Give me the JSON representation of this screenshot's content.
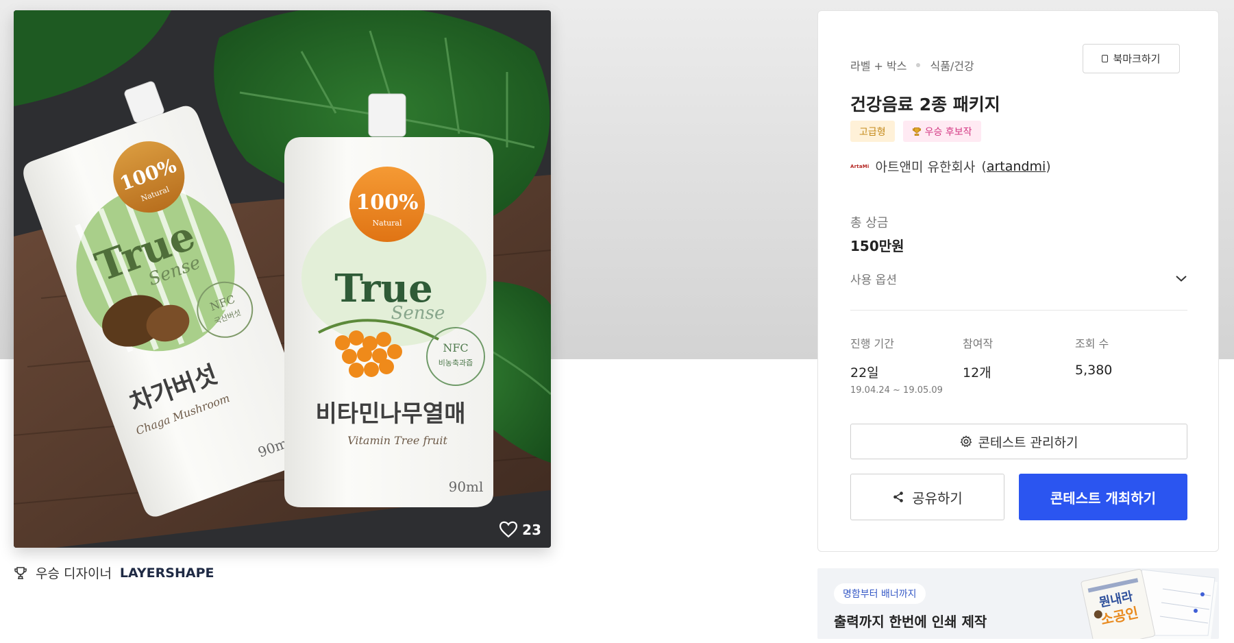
{
  "colors": {
    "primary": "#2b55f0",
    "premium_bg": "#fff1d8",
    "premium_text": "#c48a1c",
    "finalist_bg": "#ffeaf3",
    "finalist_text": "#d33883"
  },
  "product_image": {
    "left_pouch": {
      "badge_big": "100%",
      "badge_small": "Natural",
      "brand": "True",
      "brand_script": "Sense",
      "seal_top": "NFC",
      "seal_bottom": "국산버섯",
      "name_ko": "차가버섯",
      "name_en": "Chaga Mushroom",
      "volume": "90ml"
    },
    "right_pouch": {
      "badge_big": "100%",
      "badge_small": "Natural",
      "brand": "True",
      "brand_script": "Sense",
      "seal_top": "NFC",
      "seal_bottom": "비농축과즙",
      "name_ko": "비타민나무열매",
      "name_en": "Vitamin Tree fruit",
      "volume": "90ml"
    }
  },
  "likes": {
    "icon": "heart-icon",
    "count": "23"
  },
  "winner": {
    "icon": "trophy-icon",
    "label": "우승 디자이너",
    "name": "LAYERSHAPE"
  },
  "bookmark": {
    "icon": "bookmark-icon",
    "label": "북마크하기"
  },
  "breadcrumb": [
    "라벨 + 박스",
    "식품/건강"
  ],
  "title": "건강음료 2종 패키지",
  "badges": {
    "premium": "고급형",
    "finalist": "우승 후보작",
    "finalist_icon": "trophy-icon"
  },
  "company": {
    "logo_text": "ArtaMi",
    "name": "아트앤미 유한회사",
    "handle": "artandmi",
    "open_paren": "(",
    "close_paren": ")"
  },
  "prize": {
    "label": "총 상금",
    "value": "150만원"
  },
  "options": {
    "label": "사용 옵션",
    "icon": "chevron-down-icon"
  },
  "stats": {
    "period": {
      "label": "진행 기간",
      "value": "22일",
      "range": "19.04.24  ~  19.05.09"
    },
    "entries": {
      "label": "참여작",
      "value": "12개"
    },
    "views": {
      "label": "조회 수",
      "value": "5,380"
    }
  },
  "buttons": {
    "manage": "콘테스트 관리하기",
    "manage_icon": "gear-icon",
    "share": "공유하기",
    "share_icon": "share-icon",
    "host": "콘테스트 개최하기"
  },
  "banner": {
    "tag": "명함부터 배너까지",
    "text": "출력까지 한번에 인쇄 제작",
    "art_line1": "뭔내라",
    "art_line2": "소공인"
  }
}
